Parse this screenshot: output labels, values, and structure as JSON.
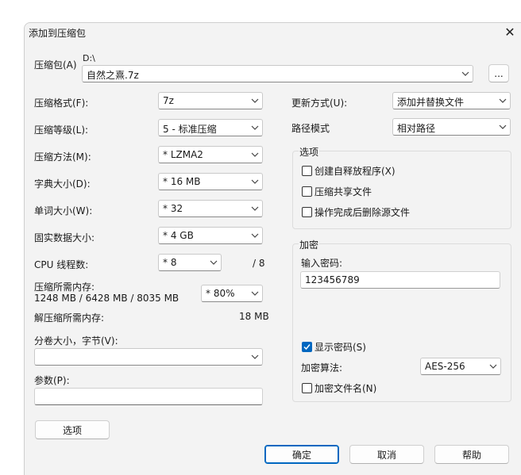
{
  "window": {
    "title": "添加到压缩包",
    "close_glyph": "✕"
  },
  "archive": {
    "label": "压缩包(A)",
    "path": "D:\\",
    "name": "自然之熹.7z",
    "browse_label": "..."
  },
  "left": {
    "format_label": "压缩格式(F):",
    "format_value": "7z",
    "level_label": "压缩等级(L):",
    "level_value": "5 - 标准压缩",
    "method_label": "压缩方法(M):",
    "method_value": "* LZMA2",
    "dict_label": "字典大小(D):",
    "dict_value": "* 16 MB",
    "word_label": "单词大小(W):",
    "word_value": "* 32",
    "solid_label": "固实数据大小:",
    "solid_value": "* 4 GB",
    "cpu_label": "CPU 线程数:",
    "cpu_value": "* 8",
    "cpu_total": "/ 8",
    "mem_label": "压缩所需内存:",
    "mem_detail": "1248 MB / 6428 MB / 8035 MB",
    "mem_value": "* 80%",
    "decomp_label": "解压缩所需内存:",
    "decomp_value": "18 MB",
    "split_label": "分卷大小，字节(V):",
    "split_value": "",
    "params_label": "参数(P):",
    "params_value": "",
    "options_button": "选项"
  },
  "right": {
    "update_label": "更新方式(U):",
    "update_value": "添加并替换文件",
    "path_label": "路径模式",
    "path_value": "相对路径",
    "options_group": {
      "title": "选项",
      "sfx": {
        "label": "创建自释放程序(X)",
        "checked": false
      },
      "shared": {
        "label": "压缩共享文件",
        "checked": false
      },
      "delete": {
        "label": "操作完成后删除源文件",
        "checked": false
      }
    },
    "encrypt_group": {
      "title": "加密",
      "pwd_label": "输入密码:",
      "pwd_value": "123456789",
      "show_pwd": {
        "label": "显示密码(S)",
        "checked": true
      },
      "algo_label": "加密算法:",
      "algo_value": "AES-256",
      "enc_names": {
        "label": "加密文件名(N)",
        "checked": false
      }
    }
  },
  "footer": {
    "ok": "确定",
    "cancel": "取消",
    "help": "帮助"
  },
  "colors": {
    "accent": "#0067c0",
    "window_bg": "#f3f3f3"
  }
}
